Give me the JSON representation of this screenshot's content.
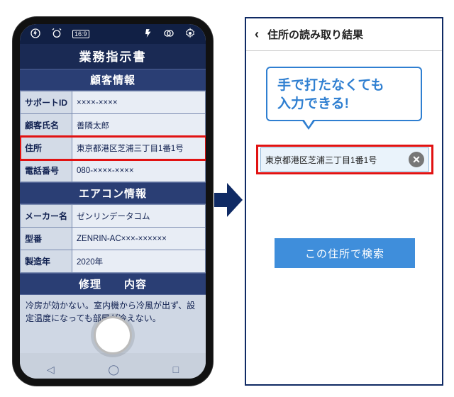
{
  "phone": {
    "doc_title": "業務指示書",
    "sections": {
      "customer": {
        "head": "顧客情報",
        "rows": [
          {
            "label": "サポートID",
            "value": "××××-××××"
          },
          {
            "label": "顧客氏名",
            "value": "善隣太郎"
          },
          {
            "label": "住所",
            "value": "東京都港区芝浦三丁目1番1号",
            "highlight": true
          },
          {
            "label": "電話番号",
            "value": "080-××××-××××"
          }
        ]
      },
      "ac": {
        "head": "エアコン情報",
        "rows": [
          {
            "label": "メーカー名",
            "value": "ゼンリンデータコム"
          },
          {
            "label": "型番",
            "value": "ZENRIN-AC×××-××××××"
          },
          {
            "label": "製造年",
            "value": "2020年"
          }
        ]
      },
      "repair": {
        "head": "修理　　内容",
        "notes": "冷房が効かない。室内機から冷風が出ず、設定温度になっても部屋が冷えない。"
      }
    }
  },
  "panel": {
    "title": "住所の読み取り結果",
    "speech_line1": "手で打たなくても",
    "speech_line2": "入力できる!",
    "address_value": "東京都港区芝浦三丁目1番1号",
    "search_label": "この住所で検索"
  }
}
